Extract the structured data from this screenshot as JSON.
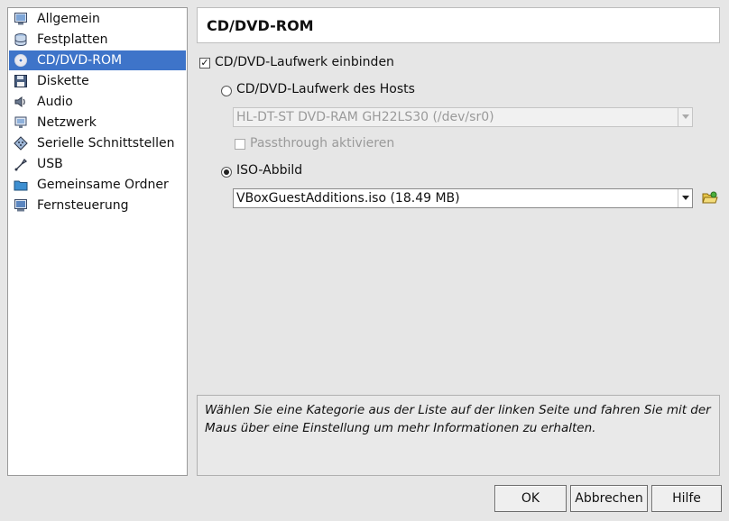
{
  "sidebar": {
    "items": [
      {
        "label": "Allgemein",
        "icon": "general-icon"
      },
      {
        "label": "Festplatten",
        "icon": "harddisk-icon"
      },
      {
        "label": "CD/DVD-ROM",
        "icon": "cd-icon"
      },
      {
        "label": "Diskette",
        "icon": "floppy-icon"
      },
      {
        "label": "Audio",
        "icon": "audio-icon"
      },
      {
        "label": "Netzwerk",
        "icon": "network-icon"
      },
      {
        "label": "Serielle Schnittstellen",
        "icon": "serial-port-icon"
      },
      {
        "label": "USB",
        "icon": "usb-icon"
      },
      {
        "label": "Gemeinsame Ordner",
        "icon": "shared-folder-icon"
      },
      {
        "label": "Fernsteuerung",
        "icon": "remote-display-icon"
      }
    ],
    "selected": "CD/DVD-ROM",
    "selected_color": "#3e74c9"
  },
  "header": {
    "title": "CD/DVD-ROM"
  },
  "cdrom": {
    "mount_label": "CD/DVD-Laufwerk einbinden",
    "mount_checked": true,
    "host_drive_label": "CD/DVD-Laufwerk des Hosts",
    "host_drive_selected": false,
    "host_drive_value": "HL-DT-ST DVD-RAM GH22LS30 (/dev/sr0)",
    "passthrough_label": "Passthrough aktivieren",
    "passthrough_checked": false,
    "iso_label": "ISO-Abbild",
    "iso_selected": true,
    "iso_value": "VBoxGuestAdditions.iso (18.49 MB)"
  },
  "info": {
    "text": "Wählen Sie eine Kategorie aus der Liste auf der linken Seite und fahren Sie mit der Maus über eine Einstellung um mehr Informationen zu erhalten."
  },
  "buttons": {
    "ok": "OK",
    "cancel": "Abbrechen",
    "help": "Hilfe"
  }
}
